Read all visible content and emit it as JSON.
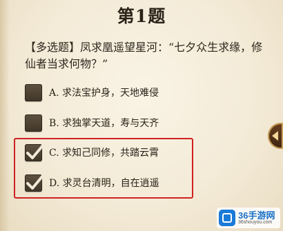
{
  "quiz": {
    "title": "第1题",
    "question": "【多选题】凤求凰遥望星河：“七夕众生求缘，修仙者当求何物？”",
    "options": [
      {
        "letter": "A.",
        "text": "求法宝护身，天地难侵",
        "checked": false
      },
      {
        "letter": "B.",
        "text": "求独掌天道，寿与天齐",
        "checked": false
      },
      {
        "letter": "C.",
        "text": "求知己同修，共踏云霄",
        "checked": true
      },
      {
        "letter": "D.",
        "text": "求灵台清明，自在逍遥",
        "checked": true
      }
    ]
  },
  "watermark": {
    "brand": "36手游网",
    "site": "36shouyou.com"
  },
  "colors": {
    "highlight": "#cf2020",
    "checkbox": "#4f4434",
    "checkmark": "#f1ead8"
  },
  "icons": {
    "checkmark": "check-icon",
    "side_arrow": "arrow-left-icon"
  }
}
